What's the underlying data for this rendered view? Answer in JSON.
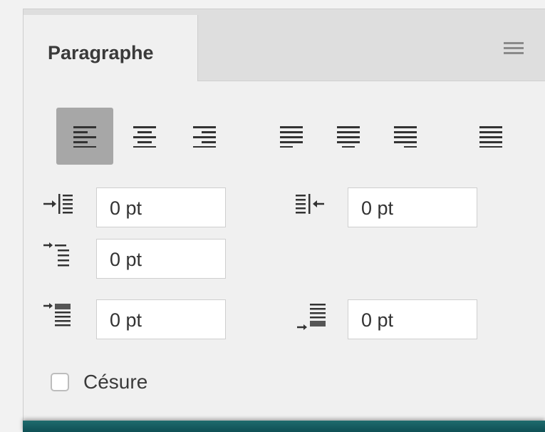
{
  "panel": {
    "tab_label": "Paragraphe",
    "menu_icon": "hamburger-menu-icon"
  },
  "alignment": {
    "buttons": [
      {
        "name": "align-left",
        "active": true
      },
      {
        "name": "align-center",
        "active": false
      },
      {
        "name": "align-right",
        "active": false
      },
      {
        "name": "justify-last-left",
        "active": false
      },
      {
        "name": "justify-last-center",
        "active": false
      },
      {
        "name": "justify-last-right",
        "active": false
      },
      {
        "name": "justify-all",
        "active": false
      }
    ]
  },
  "fields": {
    "left_indent": "0 pt",
    "right_indent": "0 pt",
    "first_line_indent": "0 pt",
    "space_before": "0 pt",
    "space_after": "0 pt"
  },
  "hyphenation": {
    "label": "Césure",
    "checked": false
  },
  "colors": {
    "panel_bg": "#f0f0f0",
    "active_button": "#a7a7a7",
    "bottom_bar": "#1f6b6d"
  }
}
